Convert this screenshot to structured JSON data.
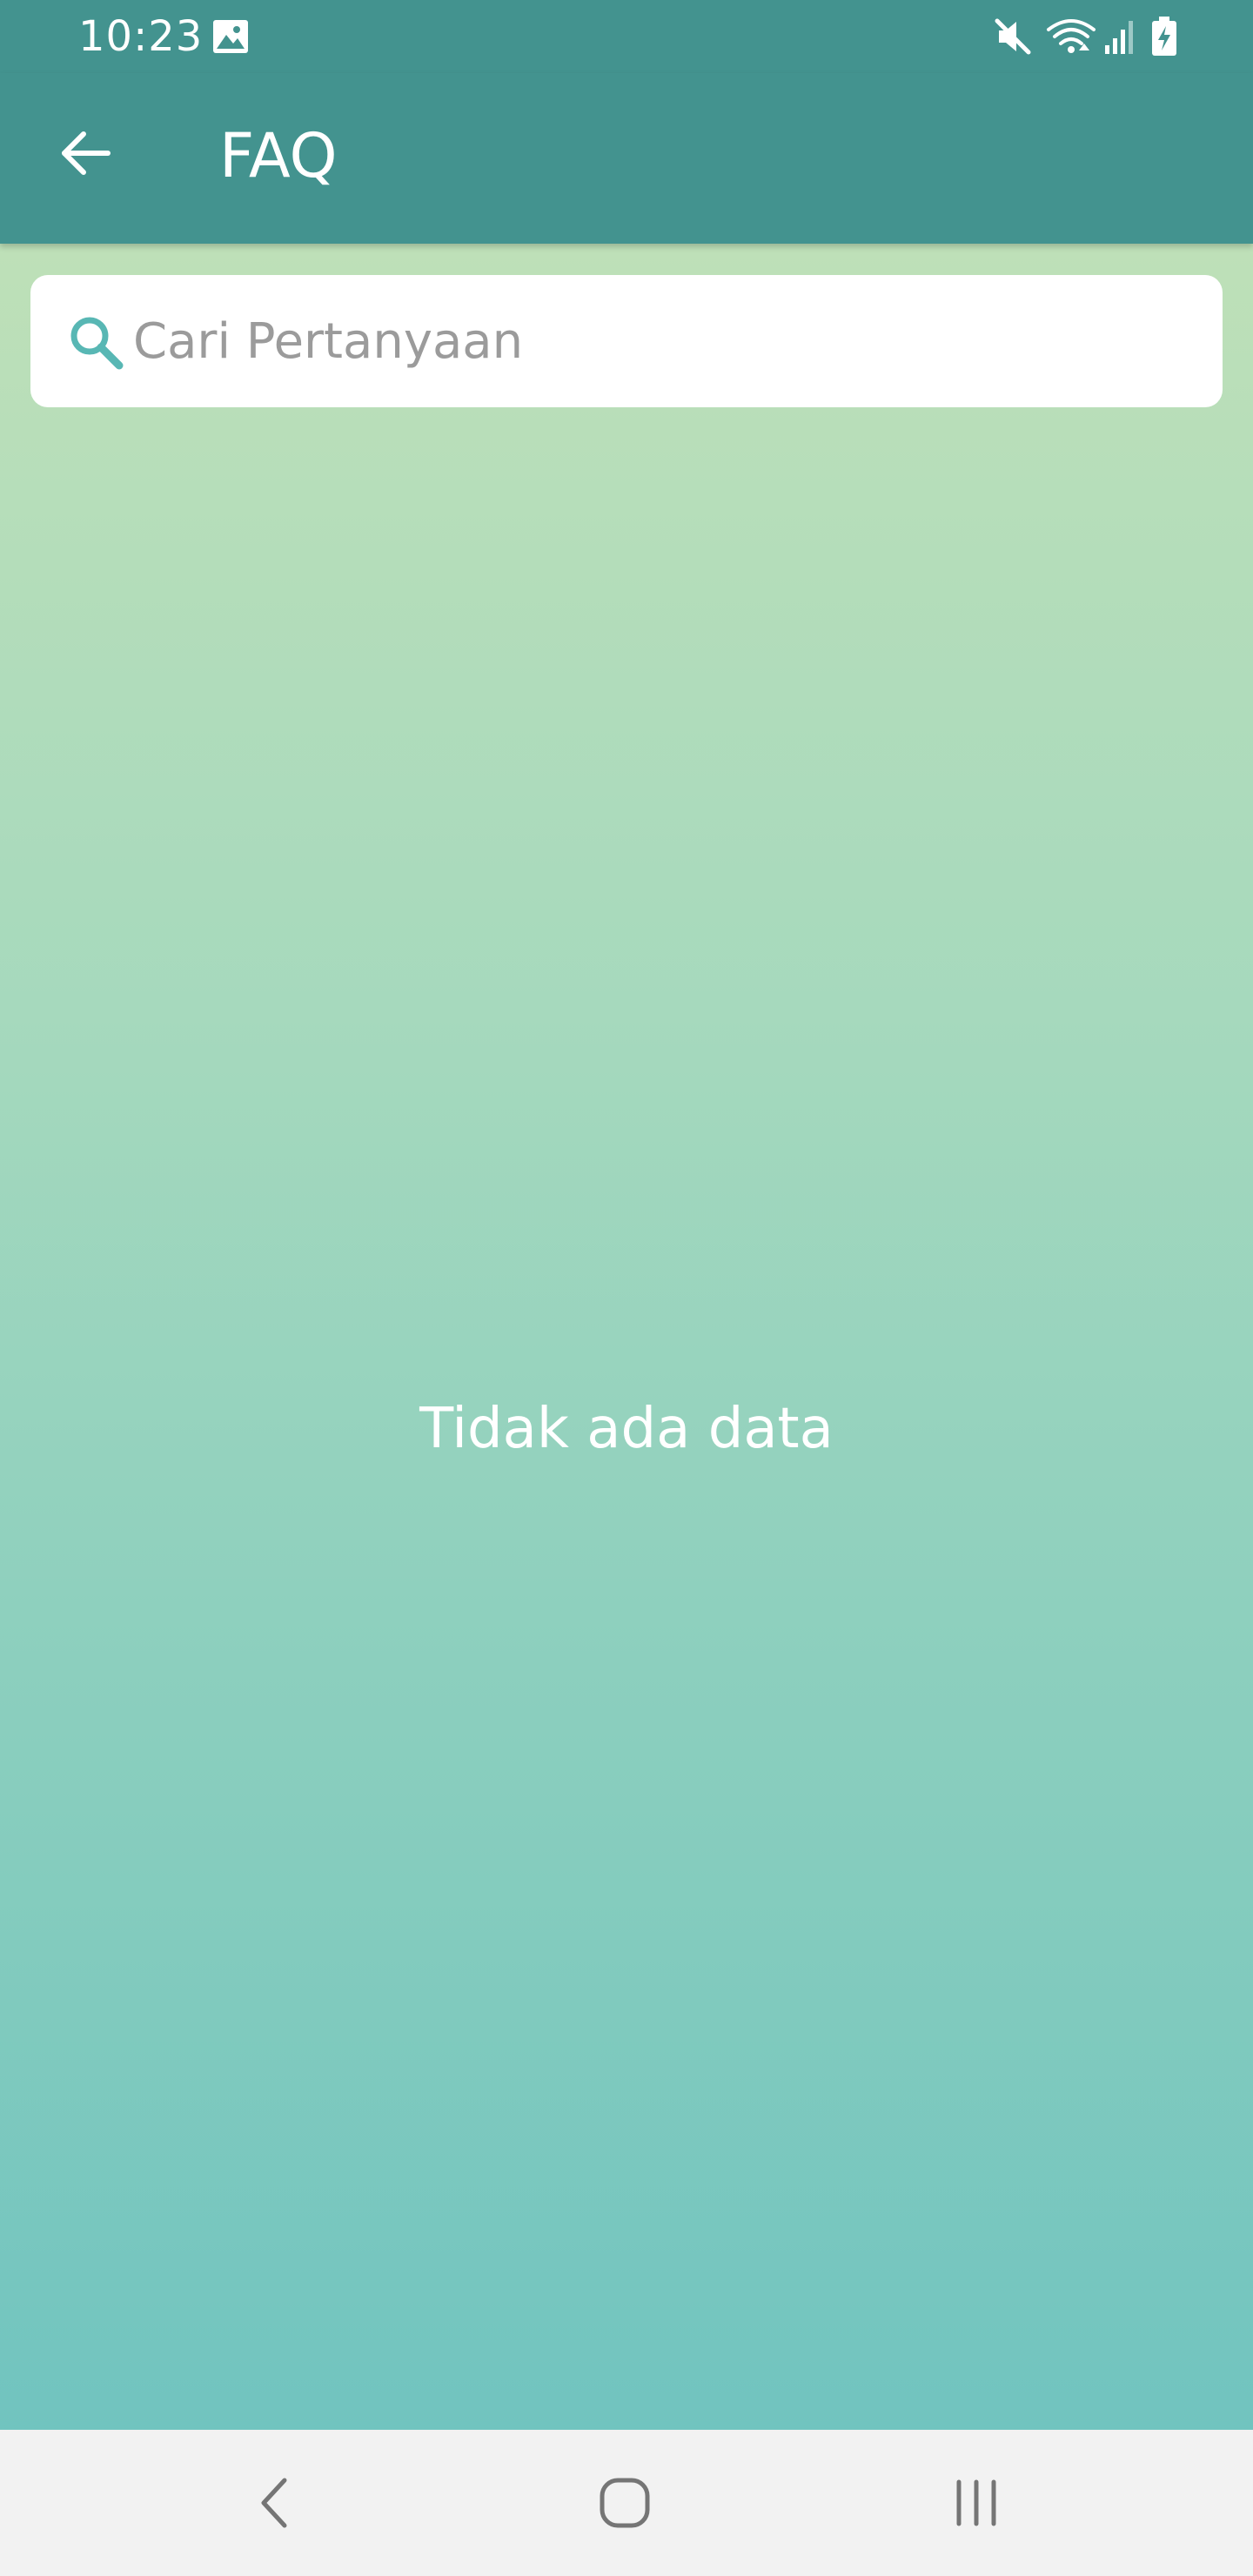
{
  "status_bar": {
    "time": "10:23",
    "icons": [
      "image-icon",
      "mute-icon",
      "wifi-icon",
      "signal-icon",
      "battery-charging-icon"
    ]
  },
  "app_bar": {
    "title": "FAQ",
    "back_icon": "arrow-left-icon"
  },
  "search": {
    "placeholder": "Cari Pertanyaan",
    "value": "",
    "icon": "search-icon"
  },
  "main": {
    "empty_message": "Tidak ada data"
  },
  "nav_bar": {
    "icons": [
      "nav-back-icon",
      "nav-home-icon",
      "nav-recents-icon"
    ]
  },
  "colors": {
    "primary": "#43938f",
    "accent": "#58b7b4",
    "gradient_top": "#bee0b8",
    "gradient_bottom": "#71c4bf",
    "nav_background": "#f2f2f2"
  }
}
